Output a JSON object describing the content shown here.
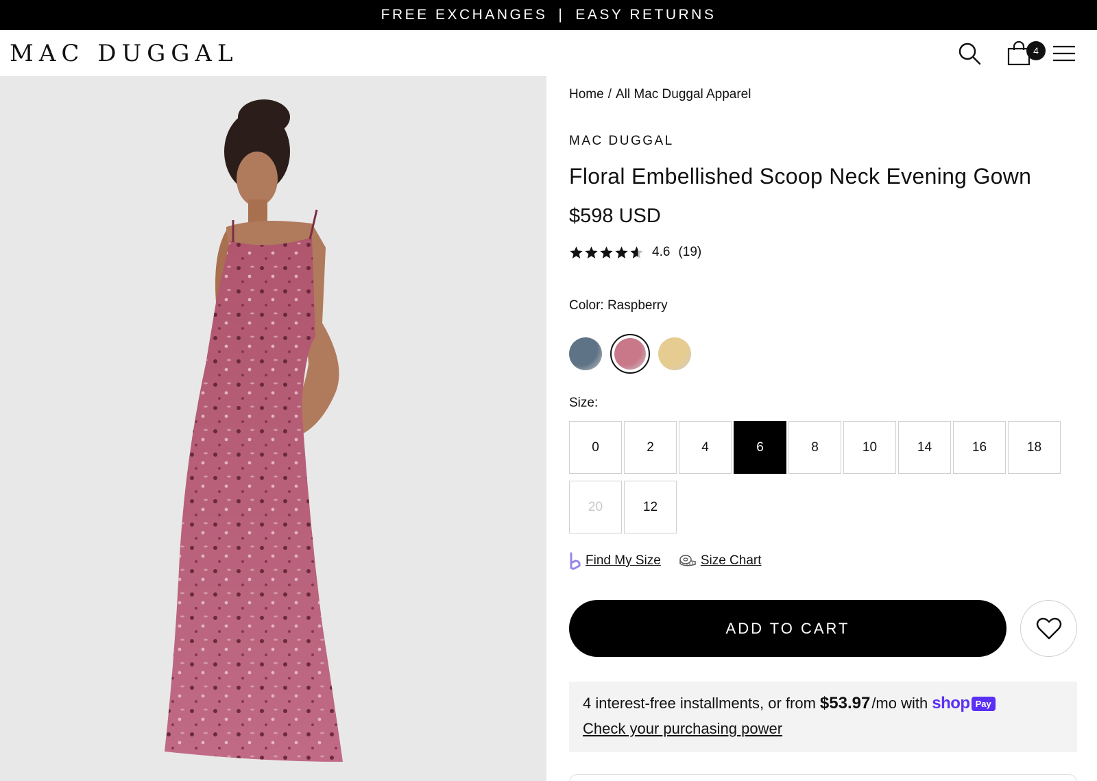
{
  "announcement": {
    "left": "FREE EXCHANGES",
    "separator": "|",
    "right": "EASY RETURNS"
  },
  "header": {
    "logo": "MAC DUGGAL",
    "cart_count": "4",
    "icons": [
      "search-icon",
      "shopping-bag-icon",
      "hamburger-menu-icon"
    ]
  },
  "gallery": {
    "image_alt": "Model wearing raspberry floral embellished scoop neck evening gown"
  },
  "breadcrumb": {
    "home": "Home",
    "separator": "/",
    "current": "All Mac Duggal Apparel"
  },
  "product": {
    "vendor": "MAC DUGGAL",
    "title": "Floral Embellished Scoop Neck Evening Gown",
    "price": "$598 USD",
    "rating": {
      "value": "4.6",
      "count": "(19)",
      "stars_filled": 4.6,
      "stars_total": 5
    },
    "color": {
      "label": "Color: Raspberry",
      "swatches": [
        {
          "name": "blue",
          "color": "#5f7386",
          "selected": false
        },
        {
          "name": "raspberry",
          "color": "#c9788a",
          "selected": true
        },
        {
          "name": "yellow",
          "color": "#e6cc90",
          "selected": false
        }
      ]
    },
    "size": {
      "label": "Size:",
      "options": [
        {
          "label": "0",
          "state": "available"
        },
        {
          "label": "2",
          "state": "available"
        },
        {
          "label": "4",
          "state": "available"
        },
        {
          "label": "6",
          "state": "selected"
        },
        {
          "label": "8",
          "state": "available"
        },
        {
          "label": "10",
          "state": "available"
        },
        {
          "label": "14",
          "state": "available"
        },
        {
          "label": "16",
          "state": "available"
        },
        {
          "label": "18",
          "state": "available"
        },
        {
          "label": "20",
          "state": "disabled"
        },
        {
          "label": "12",
          "state": "available"
        }
      ]
    },
    "links": {
      "find_my_size": "Find My Size",
      "size_chart": "Size Chart"
    },
    "add_to_cart": "ADD TO CART"
  },
  "installments": {
    "text_before": "4 interest-free installments, or from",
    "amount": "$53.97",
    "text_after": "/mo with",
    "shop_logo": "shop",
    "shop_pay_badge": "Pay",
    "link": "Check your purchasing power"
  },
  "colors": {
    "accent": "#000000",
    "shop_pay": "#5a31f4",
    "panel": "#f3f3f3"
  }
}
